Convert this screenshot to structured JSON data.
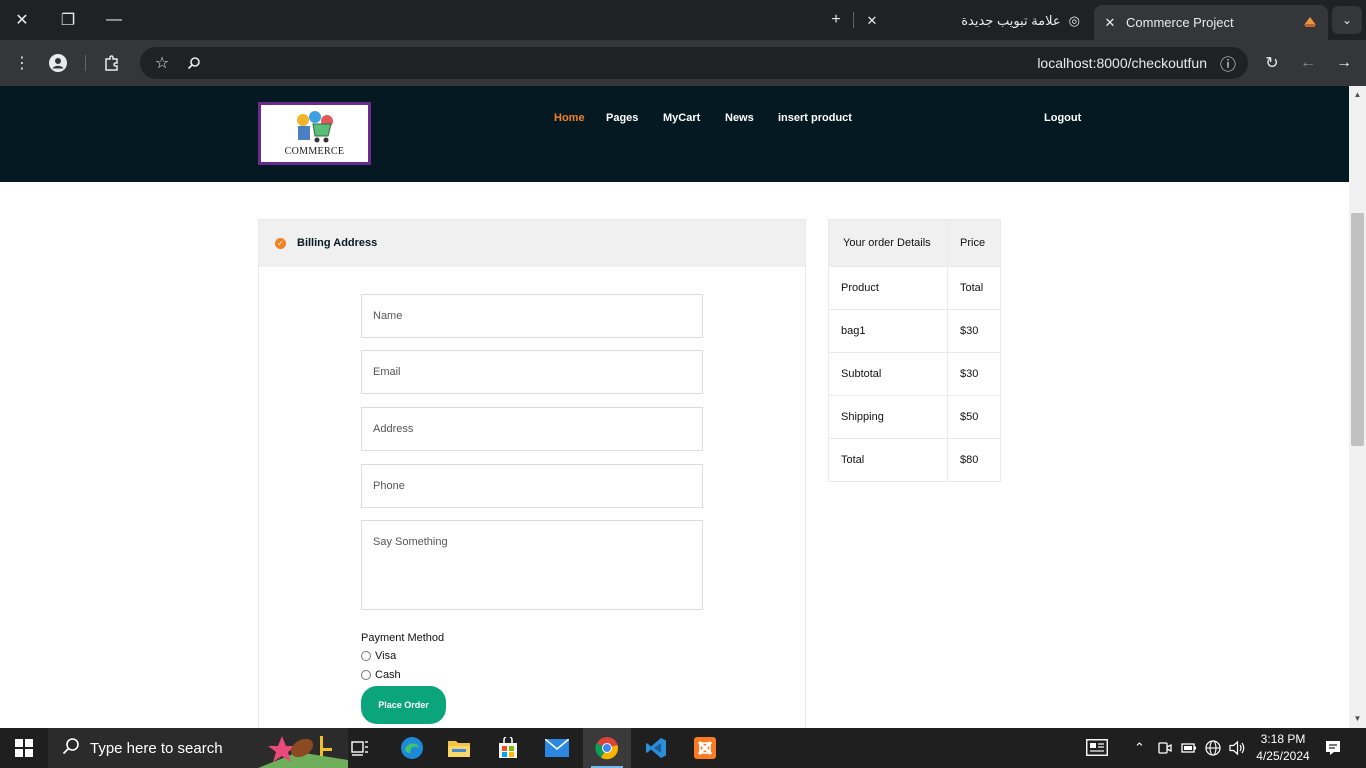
{
  "browser": {
    "tabs": [
      {
        "title": "علامة تبويب جديدة",
        "active": false
      },
      {
        "title": "Commerce Project",
        "active": true
      }
    ],
    "url": "localhost:8000/checkoutfun"
  },
  "site": {
    "logo_text": "COMMERCE",
    "nav": [
      "Home",
      "Pages",
      "MyCart",
      "News",
      "insert product"
    ],
    "logout": "Logout",
    "accent_color": "#f28123",
    "header_color": "#051922"
  },
  "billing": {
    "title": "Billing Address",
    "placeholders": {
      "name": "Name",
      "email": "Email",
      "address": "Address",
      "phone": "Phone",
      "message": "Say Something"
    },
    "payment_label": "Payment Method",
    "payment_options": [
      "Visa",
      "Cash"
    ],
    "submit": "Place Order",
    "button_color": "#0aa57a"
  },
  "order": {
    "headers": [
      "Your order Details",
      "Price"
    ],
    "rows": [
      [
        "Product",
        "Total"
      ],
      [
        "bag1",
        "$30"
      ],
      [
        "Subtotal",
        "$30"
      ],
      [
        "Shipping",
        "$50"
      ],
      [
        "Total",
        "$80"
      ]
    ]
  },
  "taskbar": {
    "search_placeholder": "Type here to search",
    "time": "3:18 PM",
    "date": "4/25/2024"
  }
}
